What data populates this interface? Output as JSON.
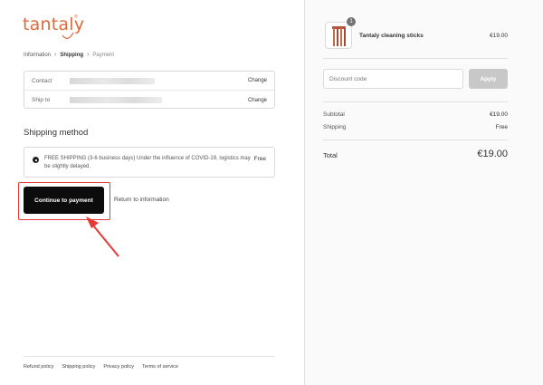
{
  "brand": {
    "name": "tantaly",
    "reg": "®",
    "color": "#e0683a"
  },
  "breadcrumb": {
    "step1": "Information",
    "step2": "Shipping",
    "step3": "Payment"
  },
  "review": {
    "contact_label": "Contact",
    "shipto_label": "Ship to",
    "change_label": "Change"
  },
  "shipping": {
    "title": "Shipping method",
    "option_text": "FREE SHIPPING (3-6 business days) Under the influence of COVID-19, logistics may be slightly delayed.",
    "option_price": "Free"
  },
  "actions": {
    "continue_label": "Continue to payment",
    "return_label": "Return to information"
  },
  "footer": {
    "links": [
      "Refund policy",
      "Shipping policy",
      "Privacy policy",
      "Terms of service"
    ]
  },
  "order": {
    "quantity": "1",
    "product_name": "Tantaly cleaning sticks",
    "product_price": "€19.00",
    "discount_placeholder": "Discount code",
    "apply_label": "Apply",
    "subtotal_label": "Subtotal",
    "subtotal_value": "€19.00",
    "shipping_label": "Shipping",
    "shipping_value": "Free",
    "total_label": "Total",
    "total_value": "€19.00"
  },
  "icons": {
    "breadcrumb_separator": "chevron-right-icon",
    "annotation": "red-arrow-icon"
  },
  "colors": {
    "annotation": "#e53935",
    "button": "#0c0c0c",
    "apply_disabled": "#c8c8c8"
  }
}
